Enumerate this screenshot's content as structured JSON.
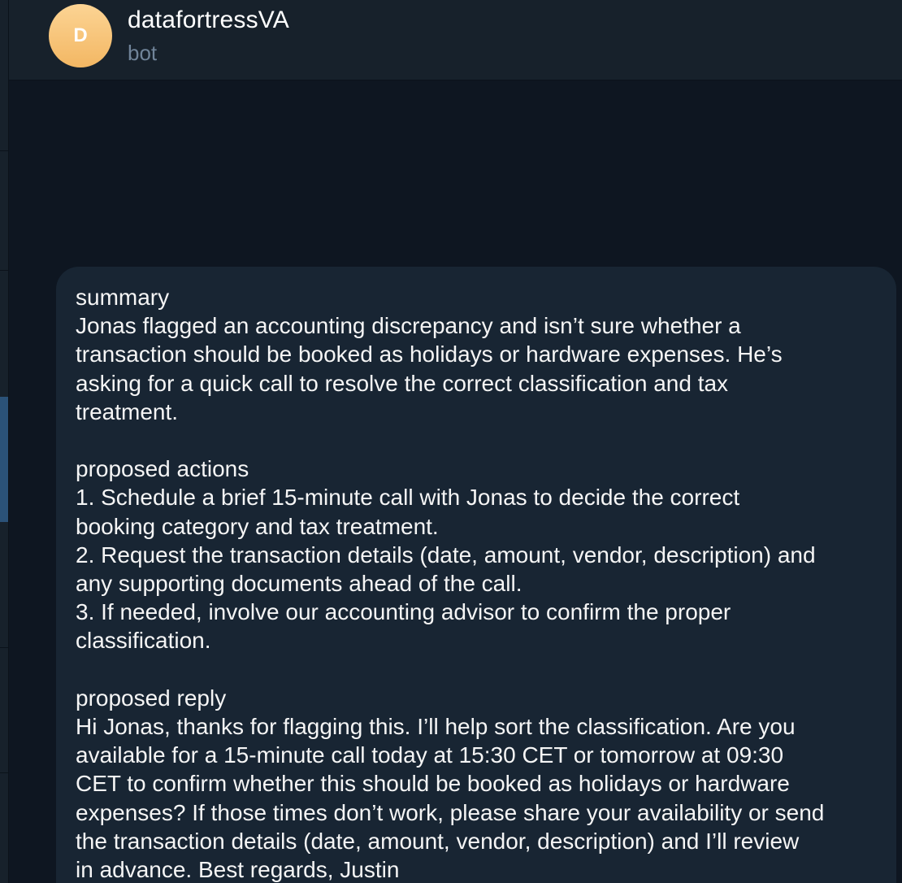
{
  "chat": {
    "name": "datafortressVA",
    "status": "bot",
    "avatar_letter": "D",
    "avatar_color": "#f5bb68"
  },
  "message": {
    "summary_heading": "summary",
    "summary_lines": [
      "Jonas flagged an accounting discrepancy and isn’t sure whether a",
      "transaction should be booked as holidays or hardware expenses. He’s",
      "asking for a quick call to resolve the correct classification and tax",
      "treatment."
    ],
    "actions_heading": "proposed actions",
    "actions_lines": [
      "1. Schedule a brief 15-minute call with Jonas to decide the correct",
      "booking category and tax treatment.",
      "2. Request the transaction details (date, amount, vendor, description) and",
      "any supporting documents ahead of the call.",
      "3. If needed, involve our accounting advisor to confirm the proper",
      "classification."
    ],
    "reply_heading": "proposed reply",
    "reply_lines": [
      "Hi Jonas, thanks for flagging this. I’ll help sort the classification. Are you",
      "available for a 15-minute call today at 15:30 CET or tomorrow at 09:30",
      "CET to confirm whether this should be booked as holidays or hardware",
      "expenses? If those times don’t work, please share your availability or send",
      "the transaction details (date, amount, vendor, description) and I’ll review",
      "in advance. Best regards, Justin"
    ]
  },
  "colors": {
    "background": "#0e1621",
    "header": "#17212b",
    "bubble": "#182533",
    "secondary_text": "#708499",
    "active_chat": "#2b5278"
  }
}
